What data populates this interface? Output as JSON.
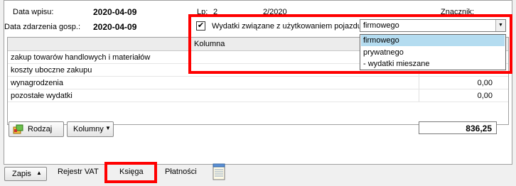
{
  "header": {
    "data_wpisu_label": "Data wpisu:",
    "data_wpisu_value": "2020-04-09",
    "data_zdarzenia_label": "Data zdarzenia gosp.:",
    "data_zdarzenia_value": "2020-04-09",
    "lp_label": "Lp:",
    "lp_value": "2",
    "doc_number": "2/2020",
    "znacznik_label": "Znacznik:"
  },
  "vehicle": {
    "checkbox_label": "Wydatki związane z użytkowaniem pojazdu",
    "checked": true,
    "selected": "firmowego",
    "options": [
      "firmowego",
      "prywatnego",
      "- wydatki mieszane"
    ]
  },
  "grid": {
    "column_header": "Kolumna",
    "rows": [
      {
        "name": "zakup towarów handlowych i materiałów",
        "amount": ""
      },
      {
        "name": "koszty uboczne zakupu",
        "amount": ""
      },
      {
        "name": "wynagrodzenia",
        "amount": "0,00"
      },
      {
        "name": "pozostałe wydatki",
        "amount": "0,00"
      }
    ]
  },
  "buttons": {
    "rodzaj": "Rodzaj",
    "kolumny": "Kolumny",
    "zapis": "Zapis"
  },
  "total": "836,25",
  "tabs": [
    "Rejestr VAT",
    "Księga",
    "Płatności"
  ],
  "colors": {
    "highlight": "#ff0000",
    "selection": "#b4dcf0"
  }
}
